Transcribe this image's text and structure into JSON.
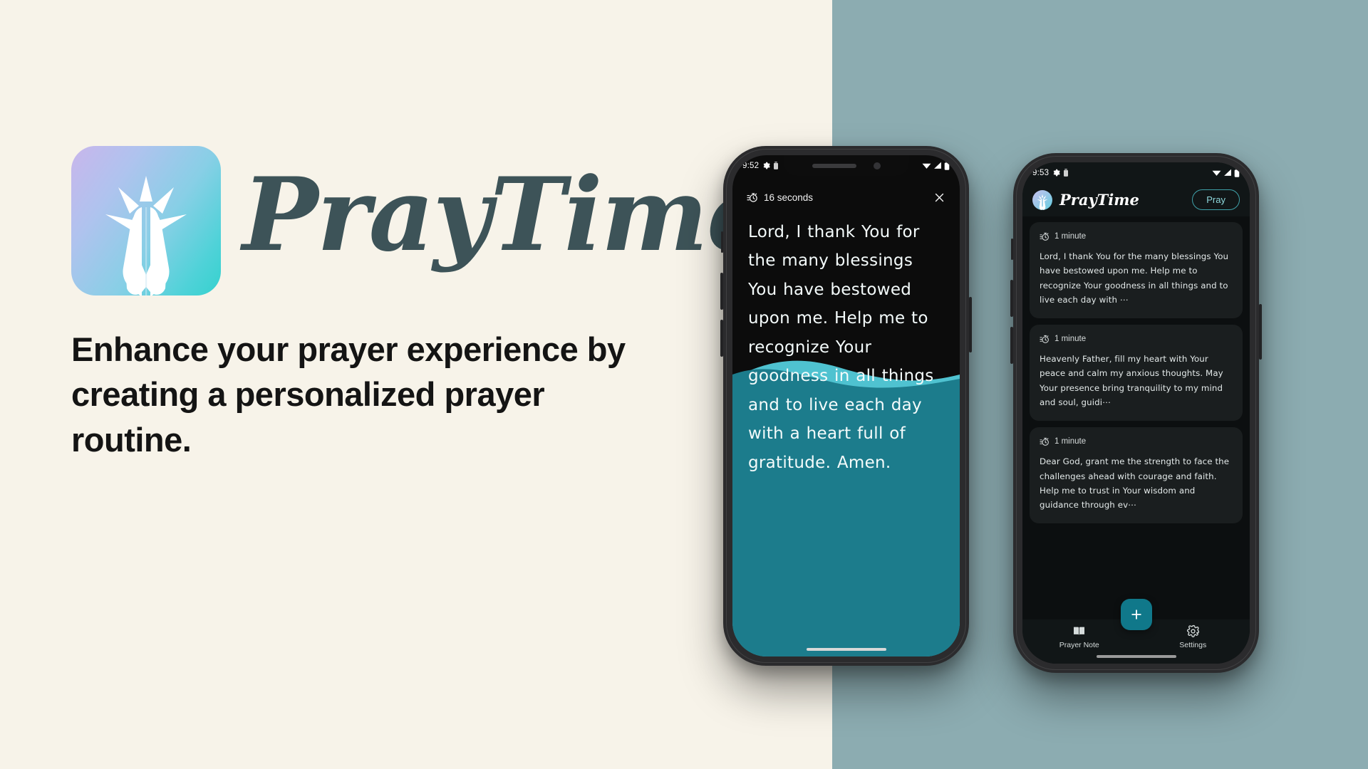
{
  "theme": {
    "bg_left": "#F7F3E9",
    "bg_right": "#8CACB1",
    "brand_dark": "#3D5358",
    "accent_teal": "#10788A",
    "wave_teal": "#1C7C8C",
    "wave_light": "#4FC2D0"
  },
  "marketing": {
    "app_icon_name": "praying-hands-icon",
    "brand_name": "PrayTime",
    "tagline": "Enhance your prayer experience by creating a personalized prayer routine."
  },
  "phone_one": {
    "status_bar": {
      "time": "9:52",
      "gear_icon": "gear-icon",
      "extra_icon": "battery-saver-icon",
      "wifi_icon": "wifi-icon",
      "signal_icon": "signal-icon",
      "battery_icon": "battery-icon"
    },
    "player": {
      "timer_icon": "stopwatch-icon",
      "timer_label": "16 seconds",
      "close_icon": "close-icon",
      "prayer_text": "Lord, I thank You for the many blessings You have bestowed upon me. Help me to recognize Your goodness in all things and to live each day with a heart full of gratitude. Amen."
    }
  },
  "phone_two": {
    "status_bar": {
      "time": "9:53",
      "gear_icon": "gear-icon",
      "extra_icon": "battery-saver-icon",
      "wifi_icon": "wifi-icon",
      "signal_icon": "signal-icon",
      "battery_icon": "battery-icon"
    },
    "app_bar": {
      "logo_icon": "praying-hands-icon",
      "title": "PrayTime",
      "pray_button": "Pray"
    },
    "cards": [
      {
        "timer_icon": "stopwatch-icon",
        "duration": "1 minute",
        "text": "Lord, I thank You for the many blessings You have bestowed upon me. Help me to recognize Your goodness in all things and to live each day with ⋯"
      },
      {
        "timer_icon": "stopwatch-icon",
        "duration": "1 minute",
        "text": "Heavenly Father, fill my heart with Your peace and calm my anxious thoughts. May Your presence bring tranquility to my mind and soul, guidi⋯"
      },
      {
        "timer_icon": "stopwatch-icon",
        "duration": "1 minute",
        "text": "Dear God, grant me the strength to face the challenges ahead with courage and faith. Help me to trust in Your wisdom and guidance through ev⋯"
      }
    ],
    "bottom_nav": {
      "items": [
        {
          "icon": "book-icon",
          "label": "Prayer Note"
        },
        {
          "icon": "gear-icon",
          "label": "Settings"
        }
      ],
      "fab_icon": "plus-icon"
    }
  }
}
